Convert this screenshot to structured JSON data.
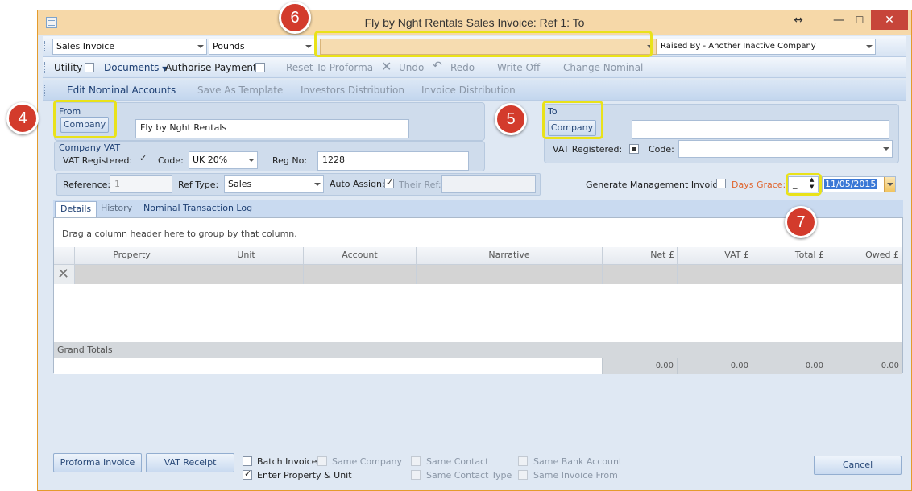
{
  "window": {
    "title": "Fly by Nght Rentals Sales Invoice: Ref 1: To",
    "restore_glyph": "↔",
    "min_glyph": "—",
    "max_glyph": "☐",
    "close_glyph": "✕"
  },
  "toolbar1": {
    "invoice_type": "Sales Invoice",
    "currency": "Pounds",
    "middle_value": "",
    "raised_by": "Raised By - Another Inactive Company"
  },
  "toolbar2": {
    "utility": "Utility",
    "documents": "Documents",
    "authorise_payment": "Authorise Payment",
    "reset_to_proforma": "Reset To Proforma",
    "undo": "Undo",
    "redo": "Redo",
    "write_off": "Write Off",
    "change_nominal": "Change Nominal"
  },
  "toolbar3": {
    "edit_nominal_accounts": "Edit Nominal Accounts",
    "save_as_template": "Save As Template",
    "investors_distribution": "Investors Distribution",
    "invoice_distribution": "Invoice Distribution"
  },
  "from": {
    "group_label": "From",
    "company_button": "Company",
    "company_name": "Fly by Nght Rentals"
  },
  "company_vat": {
    "group_label": "Company VAT",
    "vat_registered_label": "VAT Registered:",
    "code_label": "Code:",
    "code_value": "UK 20%",
    "reg_no_label": "Reg No:",
    "reg_no_value": "1228"
  },
  "to": {
    "group_label": "To",
    "company_button": "Company",
    "company_name": "",
    "vat_registered_label": "VAT Registered:",
    "code_label": "Code:",
    "code_value": ""
  },
  "reference_row": {
    "reference_label": "Reference:",
    "reference_value": "1",
    "ref_type_label": "Ref Type:",
    "ref_type_value": "Sales",
    "auto_assign_label": "Auto Assign:",
    "their_ref_label": "Their Ref:",
    "their_ref_value": "",
    "generate_mgmt_label": "Generate Management Invoice:",
    "days_grace_label": "Days Grace:",
    "days_grace_value": "_",
    "date_value": "11/05/2015"
  },
  "tabs": [
    {
      "label": "Details"
    },
    {
      "label": "History"
    },
    {
      "label": "Nominal Transaction Log"
    }
  ],
  "grid": {
    "group_hint": "Drag a column header here to group by that column.",
    "columns": [
      "Property",
      "Unit",
      "Account",
      "Narrative",
      "Net £",
      "VAT £",
      "Total £",
      "Owed £"
    ],
    "grand_totals_label": "Grand Totals",
    "totals": [
      "0.00",
      "0.00",
      "0.00",
      "0.00"
    ]
  },
  "bottom": {
    "proforma_invoice": "Proforma Invoice",
    "vat_receipt": "VAT Receipt",
    "batch_invoice": "Batch Invoice",
    "enter_property_unit": "Enter Property & Unit",
    "same_company": "Same Company",
    "same_contact": "Same Contact",
    "same_contact_type": "Same Contact Type",
    "same_bank_account": "Same Bank Account",
    "same_invoice_from": "Same Invoice From",
    "cancel": "Cancel"
  },
  "callouts": {
    "c4": "4",
    "c5": "5",
    "c6": "6",
    "c7": "7"
  },
  "colors": {
    "highlight": "#e9e21a",
    "callout": "#d33b2c",
    "accent": "#e49b2c"
  }
}
